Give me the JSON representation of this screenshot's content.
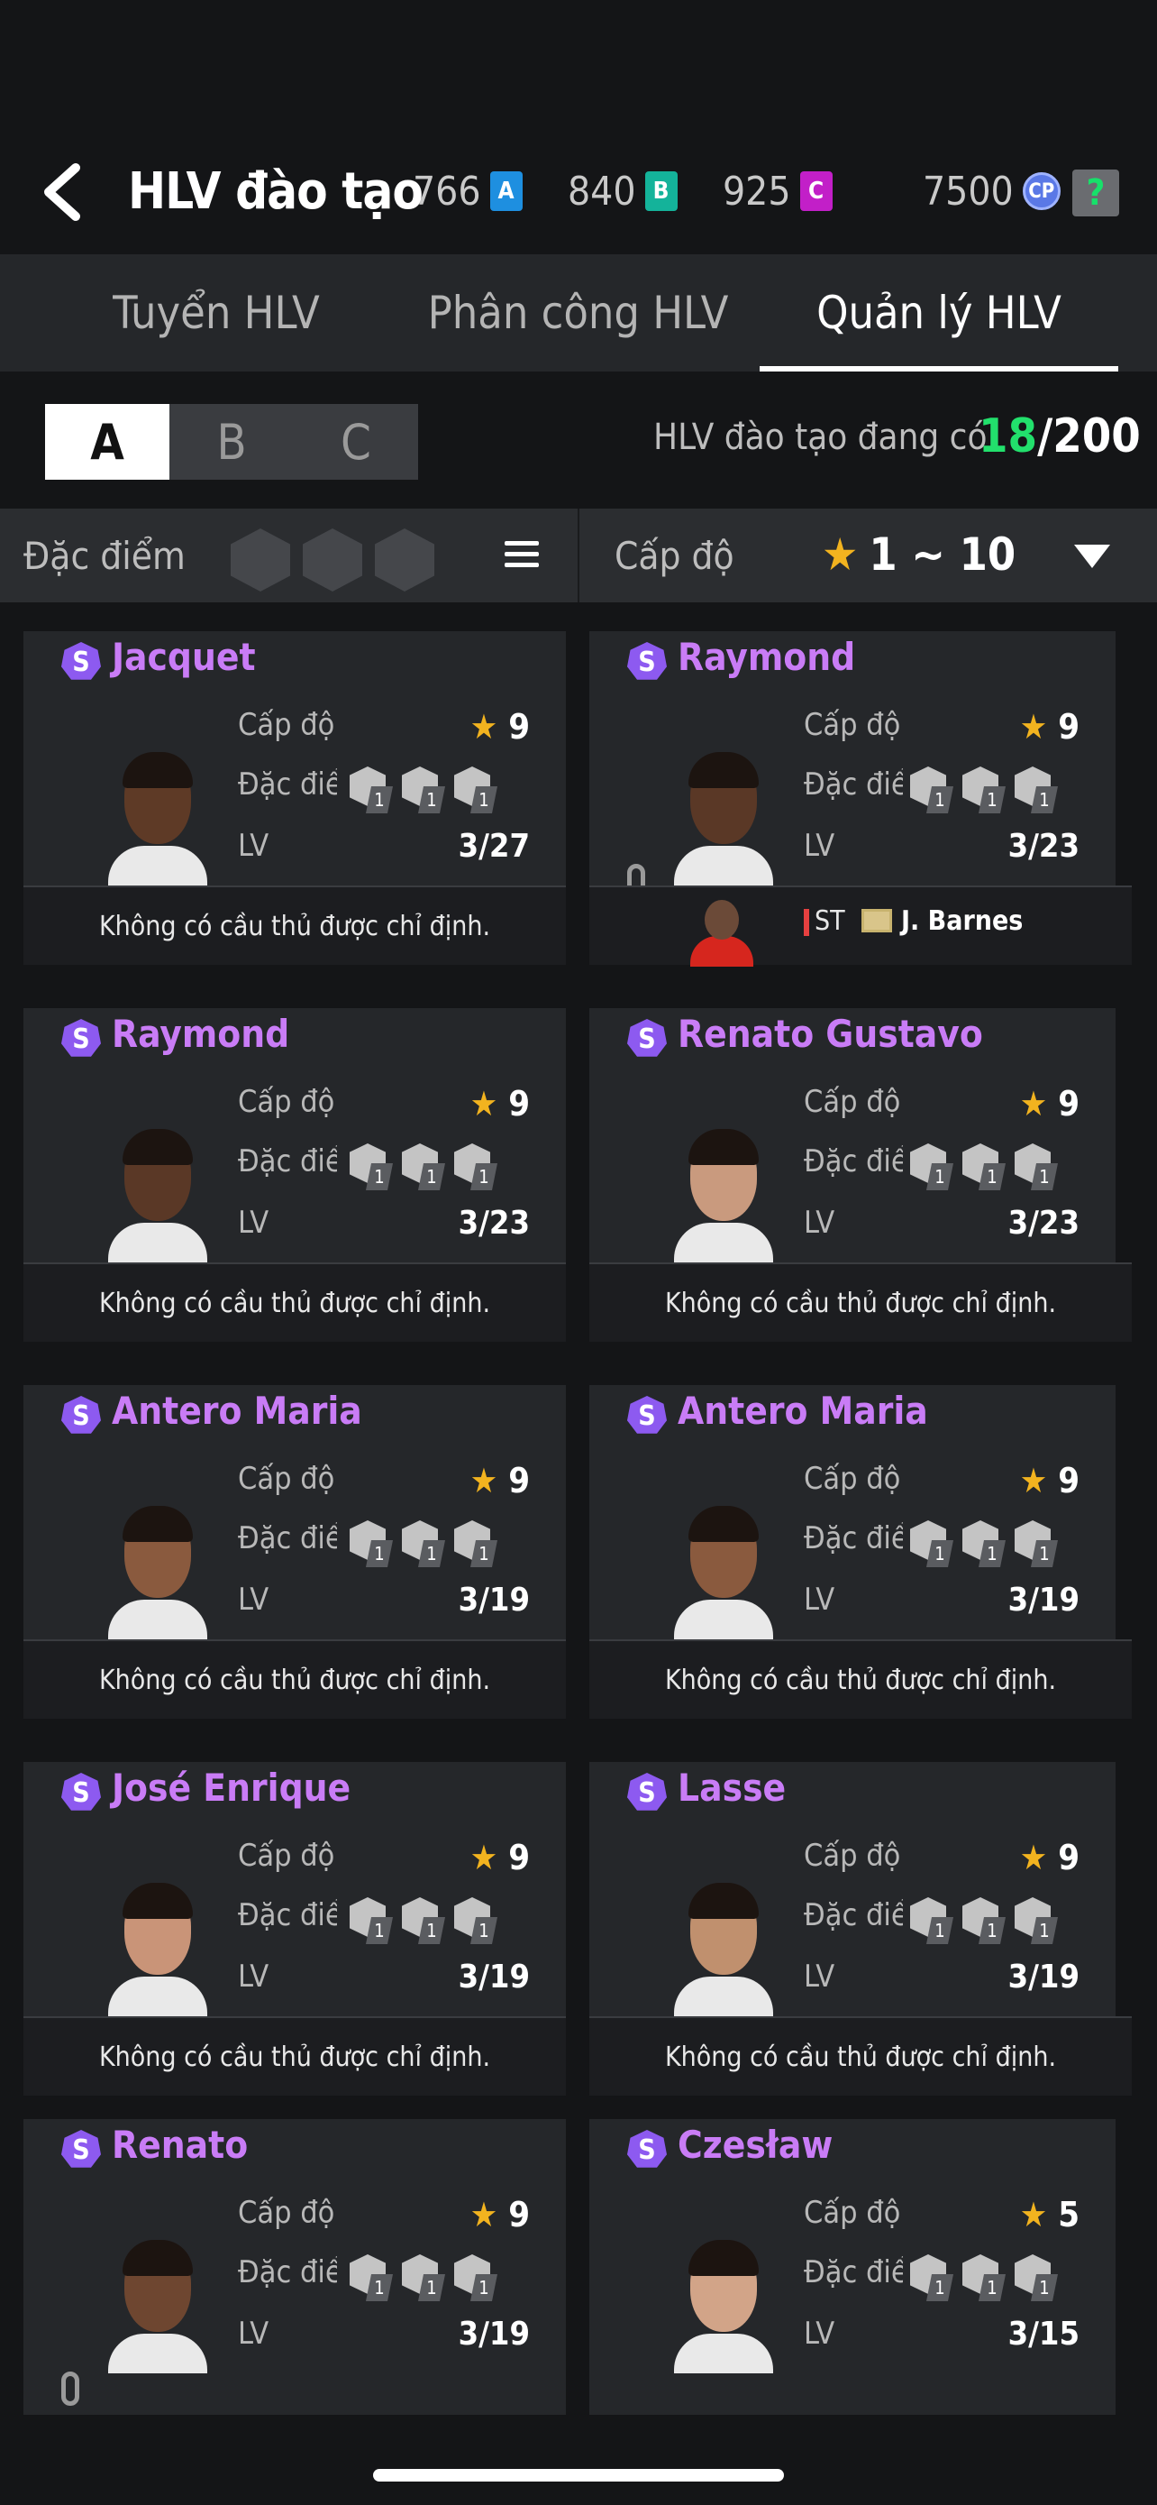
{
  "header": {
    "title": "HLV đào tạo",
    "currencies": [
      {
        "value": "766",
        "badge": "A",
        "color": "#1e8fe0"
      },
      {
        "value": "840",
        "badge": "B",
        "color": "#14b39a"
      },
      {
        "value": "925",
        "badge": "C",
        "color": "#c21fc8"
      }
    ],
    "cp": {
      "value": "7500",
      "badge": "CP"
    },
    "help": "?"
  },
  "tabs": [
    {
      "label": "Tuyển HLV",
      "active": false
    },
    {
      "label": "Phân công  HLV",
      "active": false
    },
    {
      "label": "Quản lý HLV",
      "active": true
    }
  ],
  "segment": [
    "A",
    "B",
    "C"
  ],
  "owned": {
    "label": "HLV đào tạo đang có",
    "current": "18",
    "max": "/200"
  },
  "filter": {
    "traits_label": "Đặc điểm đ",
    "level_label": "Cấp độ",
    "level_range": "1 ~ 10"
  },
  "labels": {
    "level": "Cấp độ",
    "traits": "Đặc điểm",
    "lv": "LV",
    "none": "Không có cầu thủ được chỉ định."
  },
  "coaches": [
    {
      "name": "Jacquet",
      "grade": "S",
      "level": "9",
      "lv": "3/27",
      "traits": [
        "1",
        "1",
        "1"
      ],
      "skin": "#5e3a26"
    },
    {
      "name": "Raymond",
      "grade": "S",
      "level": "9",
      "lv": "3/23",
      "traits": [
        "1",
        "1",
        "1"
      ],
      "skin": "#5a3826",
      "assigned": {
        "position": "ST",
        "player": "J. Barnes"
      }
    },
    {
      "name": "Raymond",
      "grade": "S",
      "level": "9",
      "lv": "3/23",
      "traits": [
        "1",
        "1",
        "1"
      ],
      "skin": "#5a3826"
    },
    {
      "name": "Renato Gustavo",
      "grade": "S",
      "level": "9",
      "lv": "3/23",
      "traits": [
        "1",
        "1",
        "1"
      ],
      "skin": "#c99a7e"
    },
    {
      "name": "Antero Maria",
      "grade": "S",
      "level": "9",
      "lv": "3/19",
      "traits": [
        "1",
        "1",
        "1"
      ],
      "skin": "#8a5a3e"
    },
    {
      "name": "Antero Maria",
      "grade": "S",
      "level": "9",
      "lv": "3/19",
      "traits": [
        "1",
        "1",
        "1"
      ],
      "skin": "#8a5a3e"
    },
    {
      "name": "José Enrique",
      "grade": "S",
      "level": "9",
      "lv": "3/19",
      "traits": [
        "1",
        "1",
        "1"
      ],
      "skin": "#c99478"
    },
    {
      "name": "Lasse",
      "grade": "S",
      "level": "9",
      "lv": "3/19",
      "traits": [
        "1",
        "1",
        "1"
      ],
      "skin": "#c0906e"
    },
    {
      "name": "Renato",
      "grade": "S",
      "level": "9",
      "lv": "3/19",
      "traits": [
        "1",
        "1",
        "1"
      ],
      "skin": "#6e4630"
    },
    {
      "name": "Czesław",
      "grade": "S",
      "level": "5",
      "lv": "3/15",
      "traits": [
        "1",
        "1",
        "1"
      ],
      "skin": "#d2a488"
    }
  ]
}
